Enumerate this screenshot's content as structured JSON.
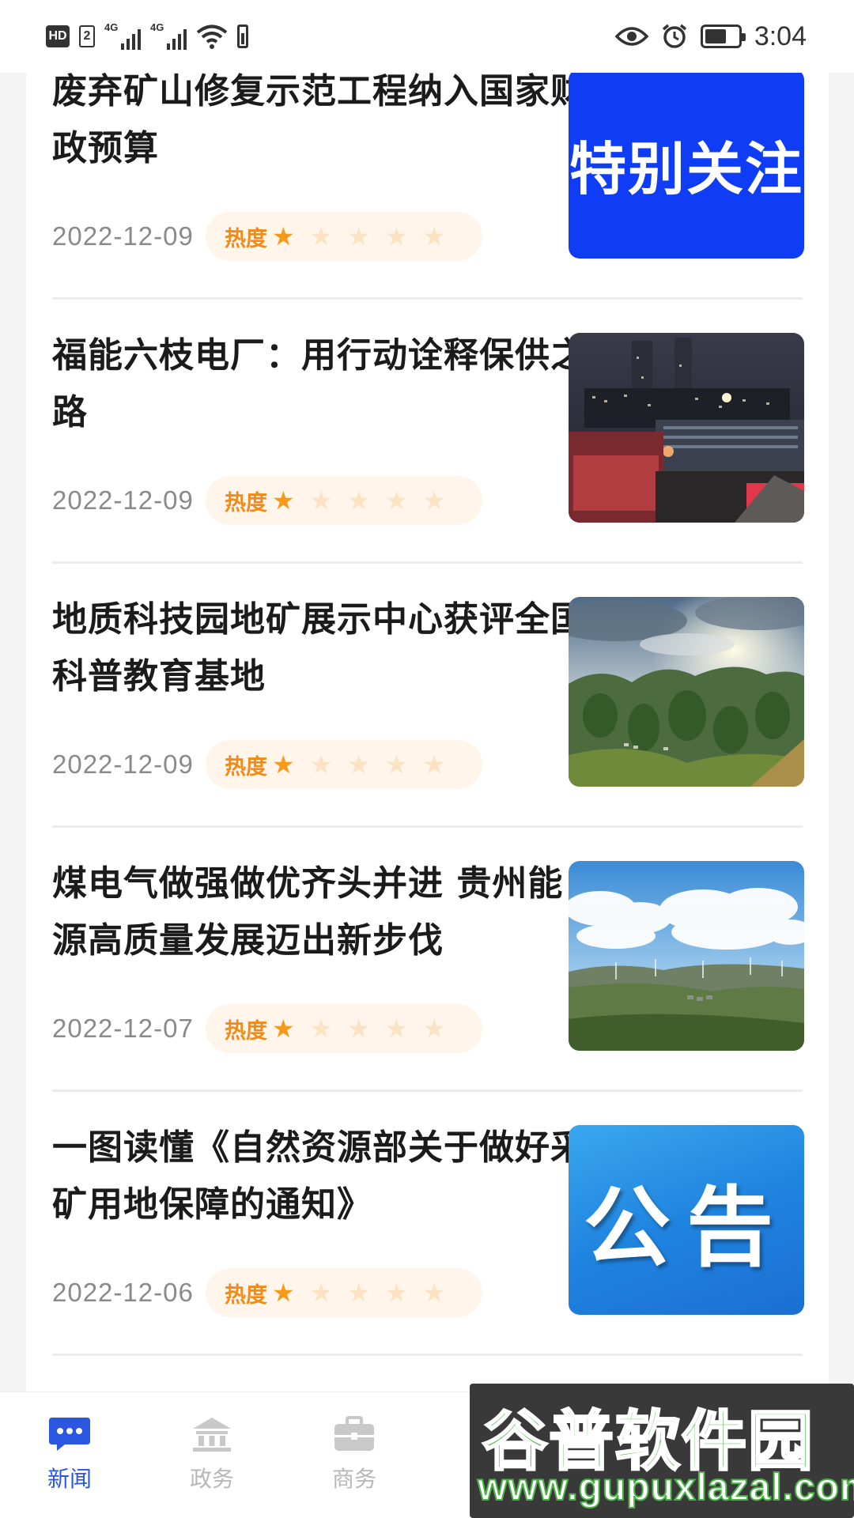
{
  "status_bar": {
    "hd": "HD",
    "sim": "2",
    "network1": "4G",
    "network2": "4G",
    "time": "3:04"
  },
  "articles": [
    {
      "title": "废弃矿山修复示范工程纳入国家财政预算",
      "date": "2022-12-09",
      "heat_label": "热度",
      "heat_stars": 1,
      "thumb_text": "特别关注",
      "thumb_kind": "text-blue"
    },
    {
      "title": "福能六枝电厂：用行动诠释保供之路",
      "date": "2022-12-09",
      "heat_label": "热度",
      "heat_stars": 1,
      "thumb_kind": "photo-night-plant"
    },
    {
      "title": "地质科技园地矿展示中心获评全国科普教育基地",
      "date": "2022-12-09",
      "heat_label": "热度",
      "heat_stars": 1,
      "thumb_kind": "photo-karst-landscape"
    },
    {
      "title": "煤电气做强做优齐头并进 贵州能源高质量发展迈出新步伐",
      "date": "2022-12-07",
      "heat_label": "热度",
      "heat_stars": 1,
      "thumb_kind": "photo-wind-farm"
    },
    {
      "title": "一图读懂《自然资源部关于做好采矿用地保障的通知》",
      "date": "2022-12-06",
      "heat_label": "热度",
      "heat_stars": 1,
      "thumb_text": "公告",
      "thumb_kind": "text-gradient-blue"
    }
  ],
  "bottom_nav": {
    "items": [
      {
        "label": "新闻",
        "icon": "chat-bubble-icon",
        "active": true
      },
      {
        "label": "政务",
        "icon": "government-building-icon",
        "active": false
      },
      {
        "label": "商务",
        "icon": "briefcase-icon",
        "active": false
      }
    ]
  },
  "watermark": {
    "logo": "谷普软件园",
    "url": "www.gupuxlazal.com"
  },
  "colors": {
    "accent_blue": "#2a56e0",
    "heat_orange": "#f08a19",
    "star_on": "#f59a1b",
    "star_off": "#fbe2c3"
  }
}
